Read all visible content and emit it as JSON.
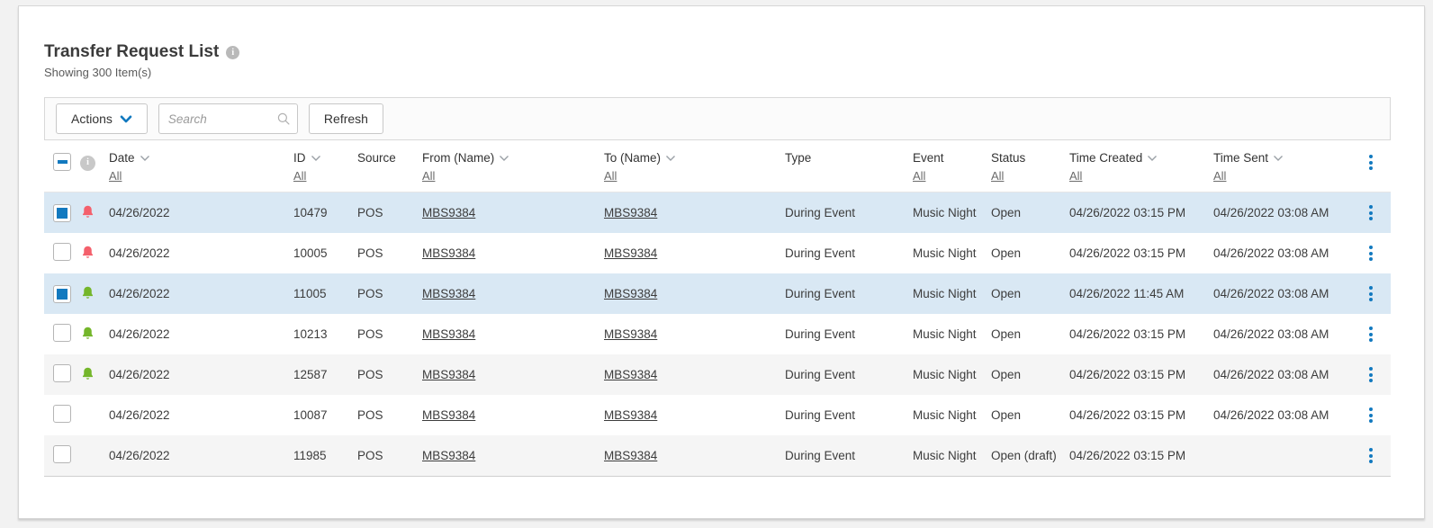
{
  "page": {
    "title": "Transfer Request List",
    "subtitle": "Showing 300 Item(s)",
    "info_glyph": "i"
  },
  "toolbar": {
    "actions_label": "Actions",
    "search_placeholder": "Search",
    "refresh_label": "Refresh"
  },
  "table": {
    "columns": [
      {
        "key": "date",
        "label": "Date",
        "sortable": true,
        "filter": "All"
      },
      {
        "key": "id",
        "label": "ID",
        "sortable": true,
        "filter": "All"
      },
      {
        "key": "source",
        "label": "Source",
        "sortable": false,
        "filter": null
      },
      {
        "key": "from",
        "label": "From (Name)",
        "sortable": true,
        "filter": "All"
      },
      {
        "key": "to",
        "label": "To (Name)",
        "sortable": true,
        "filter": "All"
      },
      {
        "key": "type",
        "label": "Type",
        "sortable": false,
        "filter": null
      },
      {
        "key": "event",
        "label": "Event",
        "sortable": false,
        "filter": "All"
      },
      {
        "key": "status",
        "label": "Status",
        "sortable": false,
        "filter": "All"
      },
      {
        "key": "created",
        "label": "Time Created",
        "sortable": true,
        "filter": "All"
      },
      {
        "key": "sent",
        "label": "Time Sent",
        "sortable": true,
        "filter": "All"
      }
    ],
    "rows": [
      {
        "selected": true,
        "alert": "red",
        "date": "04/26/2022",
        "id": "10479",
        "source": "POS",
        "from": "MBS9384",
        "to": "MBS9384",
        "type": "During Event",
        "event": "Music Night",
        "status": "Open",
        "created": "04/26/2022 03:15 PM",
        "sent": "04/26/2022 03:08 AM"
      },
      {
        "selected": false,
        "alert": "red",
        "date": "04/26/2022",
        "id": "10005",
        "source": "POS",
        "from": "MBS9384",
        "to": "MBS9384",
        "type": "During Event",
        "event": "Music Night",
        "status": "Open",
        "created": "04/26/2022 03:15 PM",
        "sent": "04/26/2022 03:08 AM"
      },
      {
        "selected": true,
        "alert": "green",
        "date": "04/26/2022",
        "id": "11005",
        "source": "POS",
        "from": "MBS9384",
        "to": "MBS9384",
        "type": "During Event",
        "event": "Music Night",
        "status": "Open",
        "created": "04/26/2022 11:45 AM",
        "sent": "04/26/2022 03:08 AM"
      },
      {
        "selected": false,
        "alert": "green",
        "date": "04/26/2022",
        "id": "10213",
        "source": "POS",
        "from": "MBS9384",
        "to": "MBS9384",
        "type": "During Event",
        "event": "Music Night",
        "status": "Open",
        "created": "04/26/2022 03:15 PM",
        "sent": "04/26/2022 03:08 AM"
      },
      {
        "selected": false,
        "alert": "green",
        "date": "04/26/2022",
        "id": "12587",
        "source": "POS",
        "from": "MBS9384",
        "to": "MBS9384",
        "type": "During Event",
        "event": "Music Night",
        "status": "Open",
        "created": "04/26/2022 03:15 PM",
        "sent": "04/26/2022 03:08 AM"
      },
      {
        "selected": false,
        "alert": null,
        "date": "04/26/2022",
        "id": "10087",
        "source": "POS",
        "from": "MBS9384",
        "to": "MBS9384",
        "type": "During Event",
        "event": "Music Night",
        "status": "Open",
        "created": "04/26/2022 03:15 PM",
        "sent": "04/26/2022 03:08 AM"
      },
      {
        "selected": false,
        "alert": null,
        "date": "04/26/2022",
        "id": "11985",
        "source": "POS",
        "from": "MBS9384",
        "to": "MBS9384",
        "type": "During Event",
        "event": "Music Night",
        "status": "Open (draft)",
        "created": "04/26/2022 03:15 PM",
        "sent": ""
      }
    ]
  },
  "colors": {
    "accent_blue": "#1279bf",
    "selected_row": "#d9e8f4",
    "striped_row": "#f5f5f5",
    "alert_red": "#f4606c",
    "alert_green": "#74b62a"
  }
}
